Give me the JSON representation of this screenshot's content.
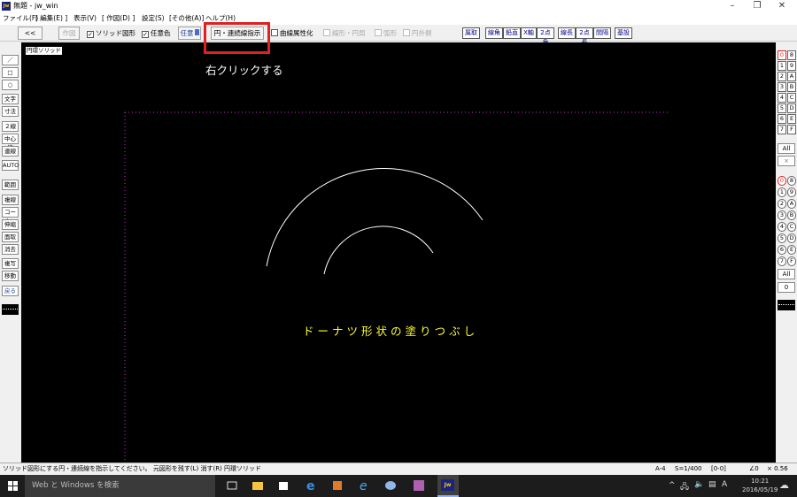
{
  "window": {
    "title": "無題 - jw_win",
    "app_icon": "Jw"
  },
  "menu": [
    "ファイル(F)",
    "[ 編集(E) ]",
    "表示(V)",
    "[ 作図(D) ]",
    "設定(S)",
    "[その他(A)]",
    "ヘルプ(H)"
  ],
  "toolbar": {
    "back": "<<",
    "sakuzu": "作図",
    "solid": "ソリッド図形",
    "ninni_color": "任意色",
    "ninni_btn": "任意",
    "circle_cont": "円・連続線指示",
    "curve_attr": "曲線属性化",
    "line_circle": "線形・円周",
    "arc": "弧形",
    "circumference": "円外側",
    "right_buttons": [
      "属取",
      "線角",
      "鉛直",
      "X軸",
      "2点角",
      "線長",
      "2点長",
      "間隔",
      "基設"
    ]
  },
  "canvas": {
    "mode_label": "円環ソリッド",
    "annotation": "右クリックする",
    "caption": "ドーナツ形状の塗りつぶし"
  },
  "left_palette": [
    "／",
    "□",
    "○",
    "文字",
    "寸法",
    "２線",
    "中心線",
    "連線",
    "AUTO",
    "範囲",
    "複線",
    "コーナー",
    "伸縮",
    "面取",
    "消去",
    "複写",
    "移動",
    "戻る"
  ],
  "right_palette": {
    "top_rows": [
      [
        "0",
        "8"
      ],
      [
        "1",
        "9"
      ],
      [
        "2",
        "A"
      ],
      [
        "3",
        "B"
      ],
      [
        "4",
        "C"
      ],
      [
        "5",
        "D"
      ],
      [
        "6",
        "E"
      ],
      [
        "7",
        "F"
      ]
    ],
    "all1": "All",
    "x": "×",
    "bottom_rows": [
      [
        "0",
        "8"
      ],
      [
        "1",
        "9"
      ],
      [
        "2",
        "A"
      ],
      [
        "3",
        "B"
      ],
      [
        "4",
        "C"
      ],
      [
        "5",
        "D"
      ],
      [
        "6",
        "E"
      ],
      [
        "7",
        "F"
      ]
    ],
    "all2": "All",
    "zero": "0"
  },
  "status": {
    "message": "ソリッド図形にする円・連続線を指示してください。 元図形を残す(L)  消す(R)  円環ソリッド",
    "paper": "A-4",
    "scale": "S=1/400",
    "layer": "[0-0]",
    "angle": "∠0",
    "zoom": "× 0.56"
  },
  "taskbar": {
    "search_placeholder": "Web と Windows を検索",
    "ime": "A",
    "time": "10:21",
    "date": "2016/05/19"
  },
  "colors": {
    "canvas_bg": "#000000",
    "caption": "#ffff33",
    "arc": "#ffffff",
    "guide": "#cc33cc",
    "highlight": "#e02020",
    "active_layer": "#ff0000"
  }
}
